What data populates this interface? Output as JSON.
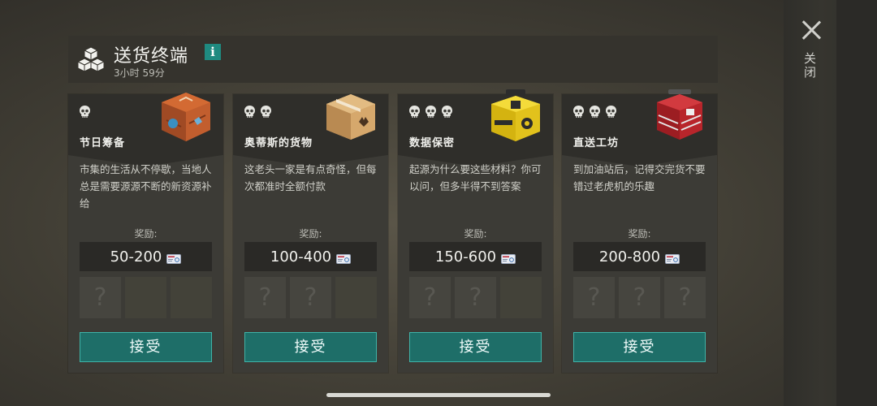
{
  "header": {
    "title": "送货终端",
    "info_icon": "i",
    "timer": "3小时 59分"
  },
  "close": {
    "label": "关闭"
  },
  "reward_label": "奖励:",
  "accept_label": "接受",
  "slot_mark": "?",
  "cards": [
    {
      "title": "节日筹备",
      "skulls": 1,
      "art": "festival-crate",
      "desc": "市集的生活从不停歇，当地人总是需要源源不断的新资源补给",
      "reward": "50-200",
      "unknown_slots": 1
    },
    {
      "title": "奥蒂斯的货物",
      "skulls": 2,
      "art": "cardboard-box",
      "desc": "这老头一家是有点奇怪，但每次都准时全额付款",
      "reward": "100-400",
      "unknown_slots": 2
    },
    {
      "title": "数据保密",
      "skulls": 3,
      "art": "hazard-case",
      "desc": "起源为什么要这些材料？你可以问，但多半得不到答案",
      "reward": "150-600",
      "unknown_slots": 2
    },
    {
      "title": "直送工坊",
      "skulls": 3,
      "art": "red-toolbox",
      "desc": "到加油站后，记得交完货不要错过老虎机的乐趣",
      "reward": "200-800",
      "unknown_slots": 3
    }
  ]
}
